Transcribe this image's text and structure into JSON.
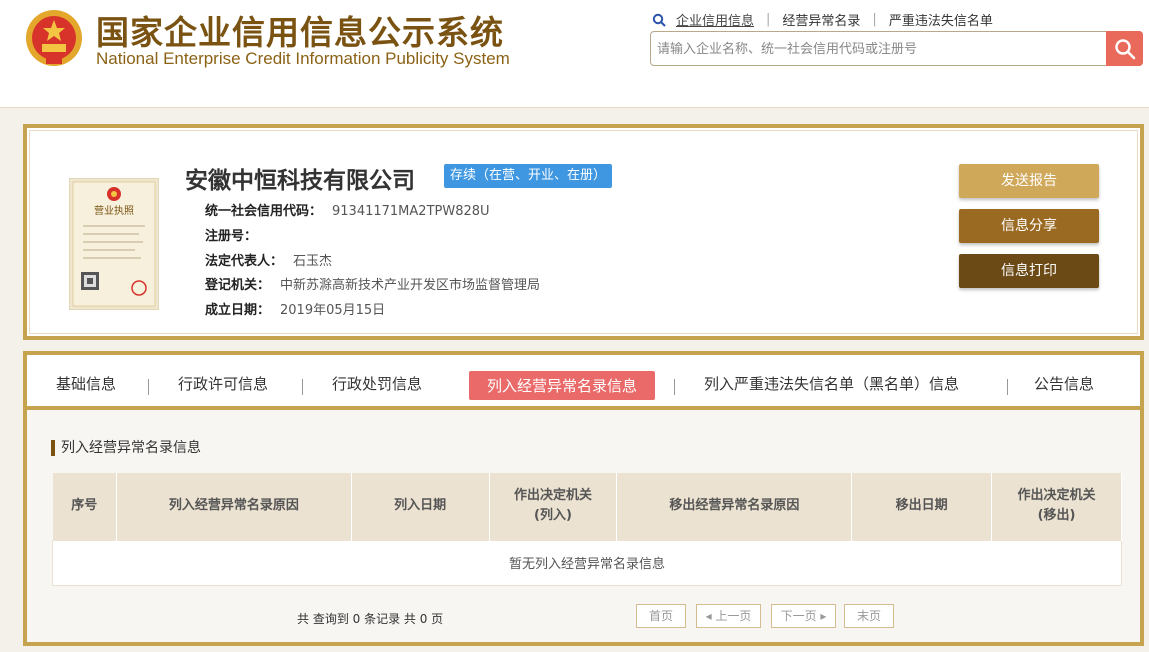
{
  "header": {
    "title": "国家企业信用信息公示系统",
    "subtitle": "National Enterprise Credit Information Publicity System",
    "nav": [
      "企业信用信息",
      "经营异常名录",
      "严重违法失信名单"
    ],
    "search_placeholder": "请输入企业名称、统一社会信用代码或注册号"
  },
  "company": {
    "name": "安徽中恒科技有限公司",
    "status": "存续（在营、开业、在册）",
    "fields": [
      {
        "label": "统一社会信用代码：",
        "value": "91341171MA2TPW828U"
      },
      {
        "label": "注册号：",
        "value": ""
      },
      {
        "label": "法定代表人：",
        "value": "石玉杰"
      },
      {
        "label": "登记机关：",
        "value": "中新苏滁高新技术产业开发区市场监督管理局"
      },
      {
        "label": "成立日期：",
        "value": "2019年05月15日"
      }
    ],
    "license_caption": "营业执照"
  },
  "actions": {
    "send_report": "发送报告",
    "share": "信息分享",
    "print": "信息打印"
  },
  "tabs": [
    "基础信息",
    "行政许可信息",
    "行政处罚信息",
    "列入经营异常名录信息",
    "列入严重违法失信名单（黑名单）信息",
    "公告信息"
  ],
  "section": {
    "title": "列入经营异常名录信息",
    "columns": [
      "序号",
      "列入经营异常名录原因",
      "列入日期",
      "作出决定机关\n(列入)",
      "移出经营异常名录原因",
      "移出日期",
      "作出决定机关\n(移出)"
    ],
    "empty_text": "暂无列入经营异常名录信息"
  },
  "pagination": {
    "summary": "共 查询到 0 条记录 共 0 页",
    "first": "首页",
    "prev": "◂ 上一页",
    "next": "下一页 ▸",
    "last": "末页"
  },
  "colors": {
    "gold": "#c6a34f",
    "brown": "#7a5312",
    "status_blue": "#3f97e1",
    "active_tab": "#ea6a6a",
    "search_button": "#e96a5b"
  }
}
